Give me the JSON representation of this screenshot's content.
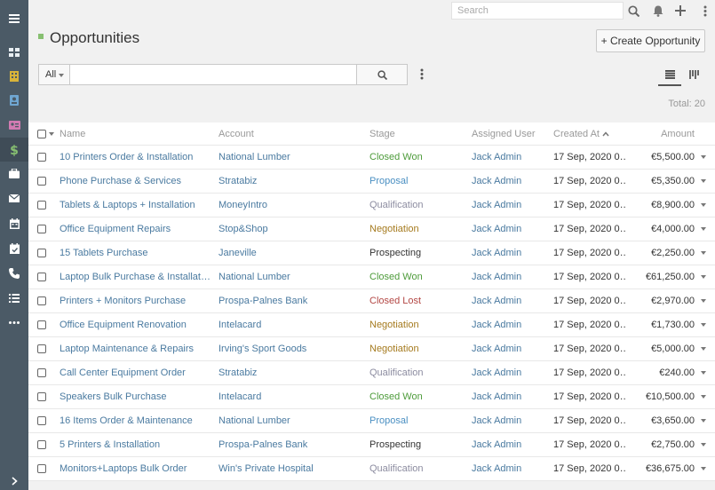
{
  "topbar": {
    "search_placeholder": "Search"
  },
  "header": {
    "title": "Opportunities",
    "create_label": "+ Create Opportunity"
  },
  "filter": {
    "scope": "All"
  },
  "total": "Total: 20",
  "columns": {
    "name": "Name",
    "account": "Account",
    "stage": "Stage",
    "user": "Assigned User",
    "created": "Created At",
    "amount": "Amount"
  },
  "stage_colors": {
    "Closed Won": "#4d9b3a",
    "Proposal": "#4a8fc2",
    "Qualification": "#8c8ca0",
    "Negotiation": "#a57a1e",
    "Prospecting": "#333333",
    "Closed Lost": "#b34744"
  },
  "accent": "#87c071",
  "sidebar_icons": [
    "menu-icon",
    "dashboard-icon",
    "accounts-icon",
    "contacts-icon",
    "leads-icon",
    "opportunities-icon",
    "cases-icon",
    "email-icon",
    "calendar-icon",
    "meetings-icon",
    "calls-icon",
    "tasks-icon",
    "more-icon",
    "collapse-icon"
  ],
  "rows": [
    {
      "name": "10 Printers Order & Installation",
      "account": "National Lumber",
      "stage": "Closed Won",
      "user": "Jack Admin",
      "created": "17 Sep, 2020 0…",
      "amount": "€5,500.00"
    },
    {
      "name": "Phone Purchase & Services",
      "account": "Stratabiz",
      "stage": "Proposal",
      "user": "Jack Admin",
      "created": "17 Sep, 2020 0…",
      "amount": "€5,350.00"
    },
    {
      "name": "Tablets & Laptops + Installation",
      "account": "MoneyIntro",
      "stage": "Qualification",
      "user": "Jack Admin",
      "created": "17 Sep, 2020 0…",
      "amount": "€8,900.00"
    },
    {
      "name": "Office Equipment Repairs",
      "account": "Stop&Shop",
      "stage": "Negotiation",
      "user": "Jack Admin",
      "created": "17 Sep, 2020 0…",
      "amount": "€4,000.00"
    },
    {
      "name": "15 Tablets Purchase",
      "account": "Janeville",
      "stage": "Prospecting",
      "user": "Jack Admin",
      "created": "17 Sep, 2020 0…",
      "amount": "€2,250.00"
    },
    {
      "name": "Laptop Bulk Purchase & Installat…",
      "account": "National Lumber",
      "stage": "Closed Won",
      "user": "Jack Admin",
      "created": "17 Sep, 2020 0…",
      "amount": "€61,250.00"
    },
    {
      "name": "Printers + Monitors Purchase",
      "account": "Prospa-Palnes Bank",
      "stage": "Closed Lost",
      "user": "Jack Admin",
      "created": "17 Sep, 2020 0…",
      "amount": "€2,970.00"
    },
    {
      "name": "Office Equipment Renovation",
      "account": "Intelacard",
      "stage": "Negotiation",
      "user": "Jack Admin",
      "created": "17 Sep, 2020 0…",
      "amount": "€1,730.00"
    },
    {
      "name": "Laptop Maintenance & Repairs",
      "account": "Irving's Sport Goods",
      "stage": "Negotiation",
      "user": "Jack Admin",
      "created": "17 Sep, 2020 0…",
      "amount": "€5,000.00"
    },
    {
      "name": "Call Center Equipment Order",
      "account": "Stratabiz",
      "stage": "Qualification",
      "user": "Jack Admin",
      "created": "17 Sep, 2020 0…",
      "amount": "€240.00"
    },
    {
      "name": "Speakers Bulk Purchase",
      "account": "Intelacard",
      "stage": "Closed Won",
      "user": "Jack Admin",
      "created": "17 Sep, 2020 0…",
      "amount": "€10,500.00"
    },
    {
      "name": "16 Items Order & Maintenance",
      "account": "National Lumber",
      "stage": "Proposal",
      "user": "Jack Admin",
      "created": "17 Sep, 2020 0…",
      "amount": "€3,650.00"
    },
    {
      "name": "5 Printers & Installation",
      "account": "Prospa-Palnes Bank",
      "stage": "Prospecting",
      "user": "Jack Admin",
      "created": "17 Sep, 2020 0…",
      "amount": "€2,750.00"
    },
    {
      "name": "Monitors+Laptops Bulk Order",
      "account": "Win's Private Hospital",
      "stage": "Qualification",
      "user": "Jack Admin",
      "created": "17 Sep, 2020 0…",
      "amount": "€36,675.00"
    }
  ]
}
